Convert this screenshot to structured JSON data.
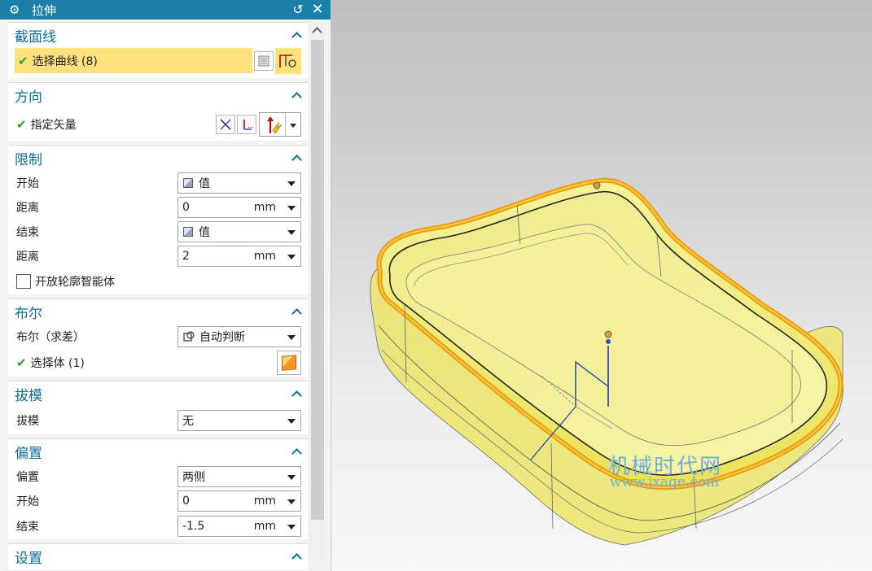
{
  "dialog": {
    "title": "拉伸",
    "settings_icon": "gear-icon",
    "reset_icon": "reset-icon",
    "close_icon": "close-icon"
  },
  "sections": {
    "section_curve": {
      "title": "截面线",
      "select_curve": "选择曲线 (8)"
    },
    "direction": {
      "title": "方向",
      "specify_vector": "指定矢量"
    },
    "limits": {
      "title": "限制",
      "start_label": "开始",
      "start_value": "值",
      "start_distance_label": "距离",
      "start_distance_value": "0",
      "start_distance_unit": "mm",
      "end_label": "结束",
      "end_value": "值",
      "end_distance_label": "距离",
      "end_distance_value": "2",
      "end_distance_unit": "mm",
      "open_profile": "开放轮廓智能体"
    },
    "boolean": {
      "title": "布尔",
      "boolean_label": "布尔（求差）",
      "boolean_value": "自动判断",
      "select_body": "选择体 (1)"
    },
    "draft": {
      "title": "拔模",
      "draft_label": "拔模",
      "draft_value": "无"
    },
    "offset": {
      "title": "偏置",
      "offset_label": "偏置",
      "offset_value": "两侧",
      "start_label": "开始",
      "start_value": "0",
      "start_unit": "mm",
      "end_label": "结束",
      "end_value": "-1.5",
      "end_unit": "mm"
    },
    "settings": {
      "title": "设置"
    }
  },
  "viewport": {
    "watermark_cn": "机械时代网",
    "watermark_en": "www.jxage.com",
    "model_colors": {
      "body": "#f3ef7a",
      "rim": "#f3a020",
      "edge": "#333333",
      "axis": "#1a3fb0"
    }
  }
}
